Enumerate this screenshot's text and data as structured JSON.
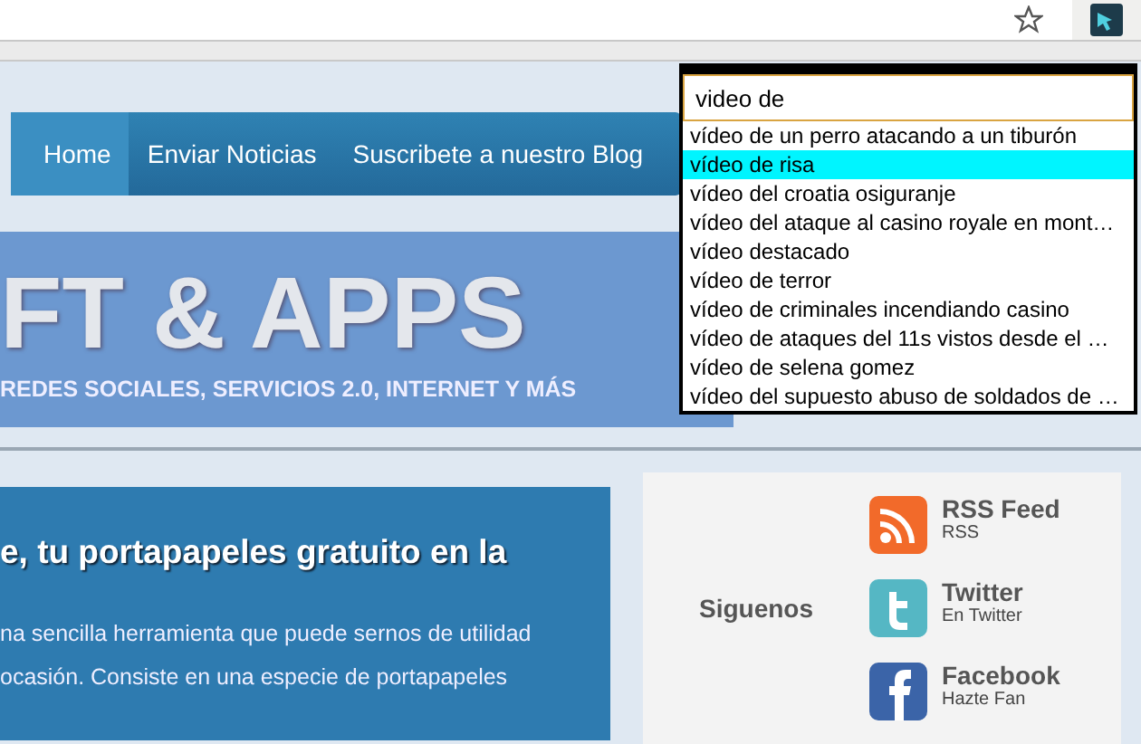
{
  "suggest": {
    "value": "video de",
    "items": [
      {
        "label": "vídeo de un perro atacando a un tiburón",
        "selected": false
      },
      {
        "label": "vídeo de risa",
        "selected": true
      },
      {
        "label": "vídeo del croatia osiguranje",
        "selected": false
      },
      {
        "label": "vídeo del ataque al casino royale en mont…",
        "selected": false
      },
      {
        "label": "vídeo destacado",
        "selected": false
      },
      {
        "label": "vídeo de terror",
        "selected": false
      },
      {
        "label": "vídeo de criminales incendiando casino",
        "selected": false
      },
      {
        "label": "vídeo de ataques del 11s vistos desde el …",
        "selected": false
      },
      {
        "label": "vídeo de selena gomez",
        "selected": false
      },
      {
        "label": "vídeo del supuesto abuso de soldados de …",
        "selected": false
      }
    ]
  },
  "nav": [
    {
      "label": "Home",
      "selected": true
    },
    {
      "label": "Enviar Noticias",
      "selected": false
    },
    {
      "label": "Suscribete a nuestro Blog",
      "selected": false
    }
  ],
  "banner": {
    "title": "FT & APPS",
    "tagline": "REDES SOCIALES, SERVICIOS 2.0, INTERNET Y MÁS"
  },
  "article": {
    "title": "e, tu portapapeles gratuito en la",
    "lines": [
      "na sencilla herramienta que puede sernos de utilidad",
      "ocasión. Consiste en una especie de portapapeles"
    ]
  },
  "follow": {
    "label": "Siguenos",
    "items": [
      {
        "kind": "rss",
        "title": "RSS Feed",
        "subtitle": "RSS"
      },
      {
        "kind": "twitter",
        "title": "Twitter",
        "subtitle": "En Twitter"
      },
      {
        "kind": "facebook",
        "title": "Facebook",
        "subtitle": "Hazte Fan"
      }
    ]
  }
}
